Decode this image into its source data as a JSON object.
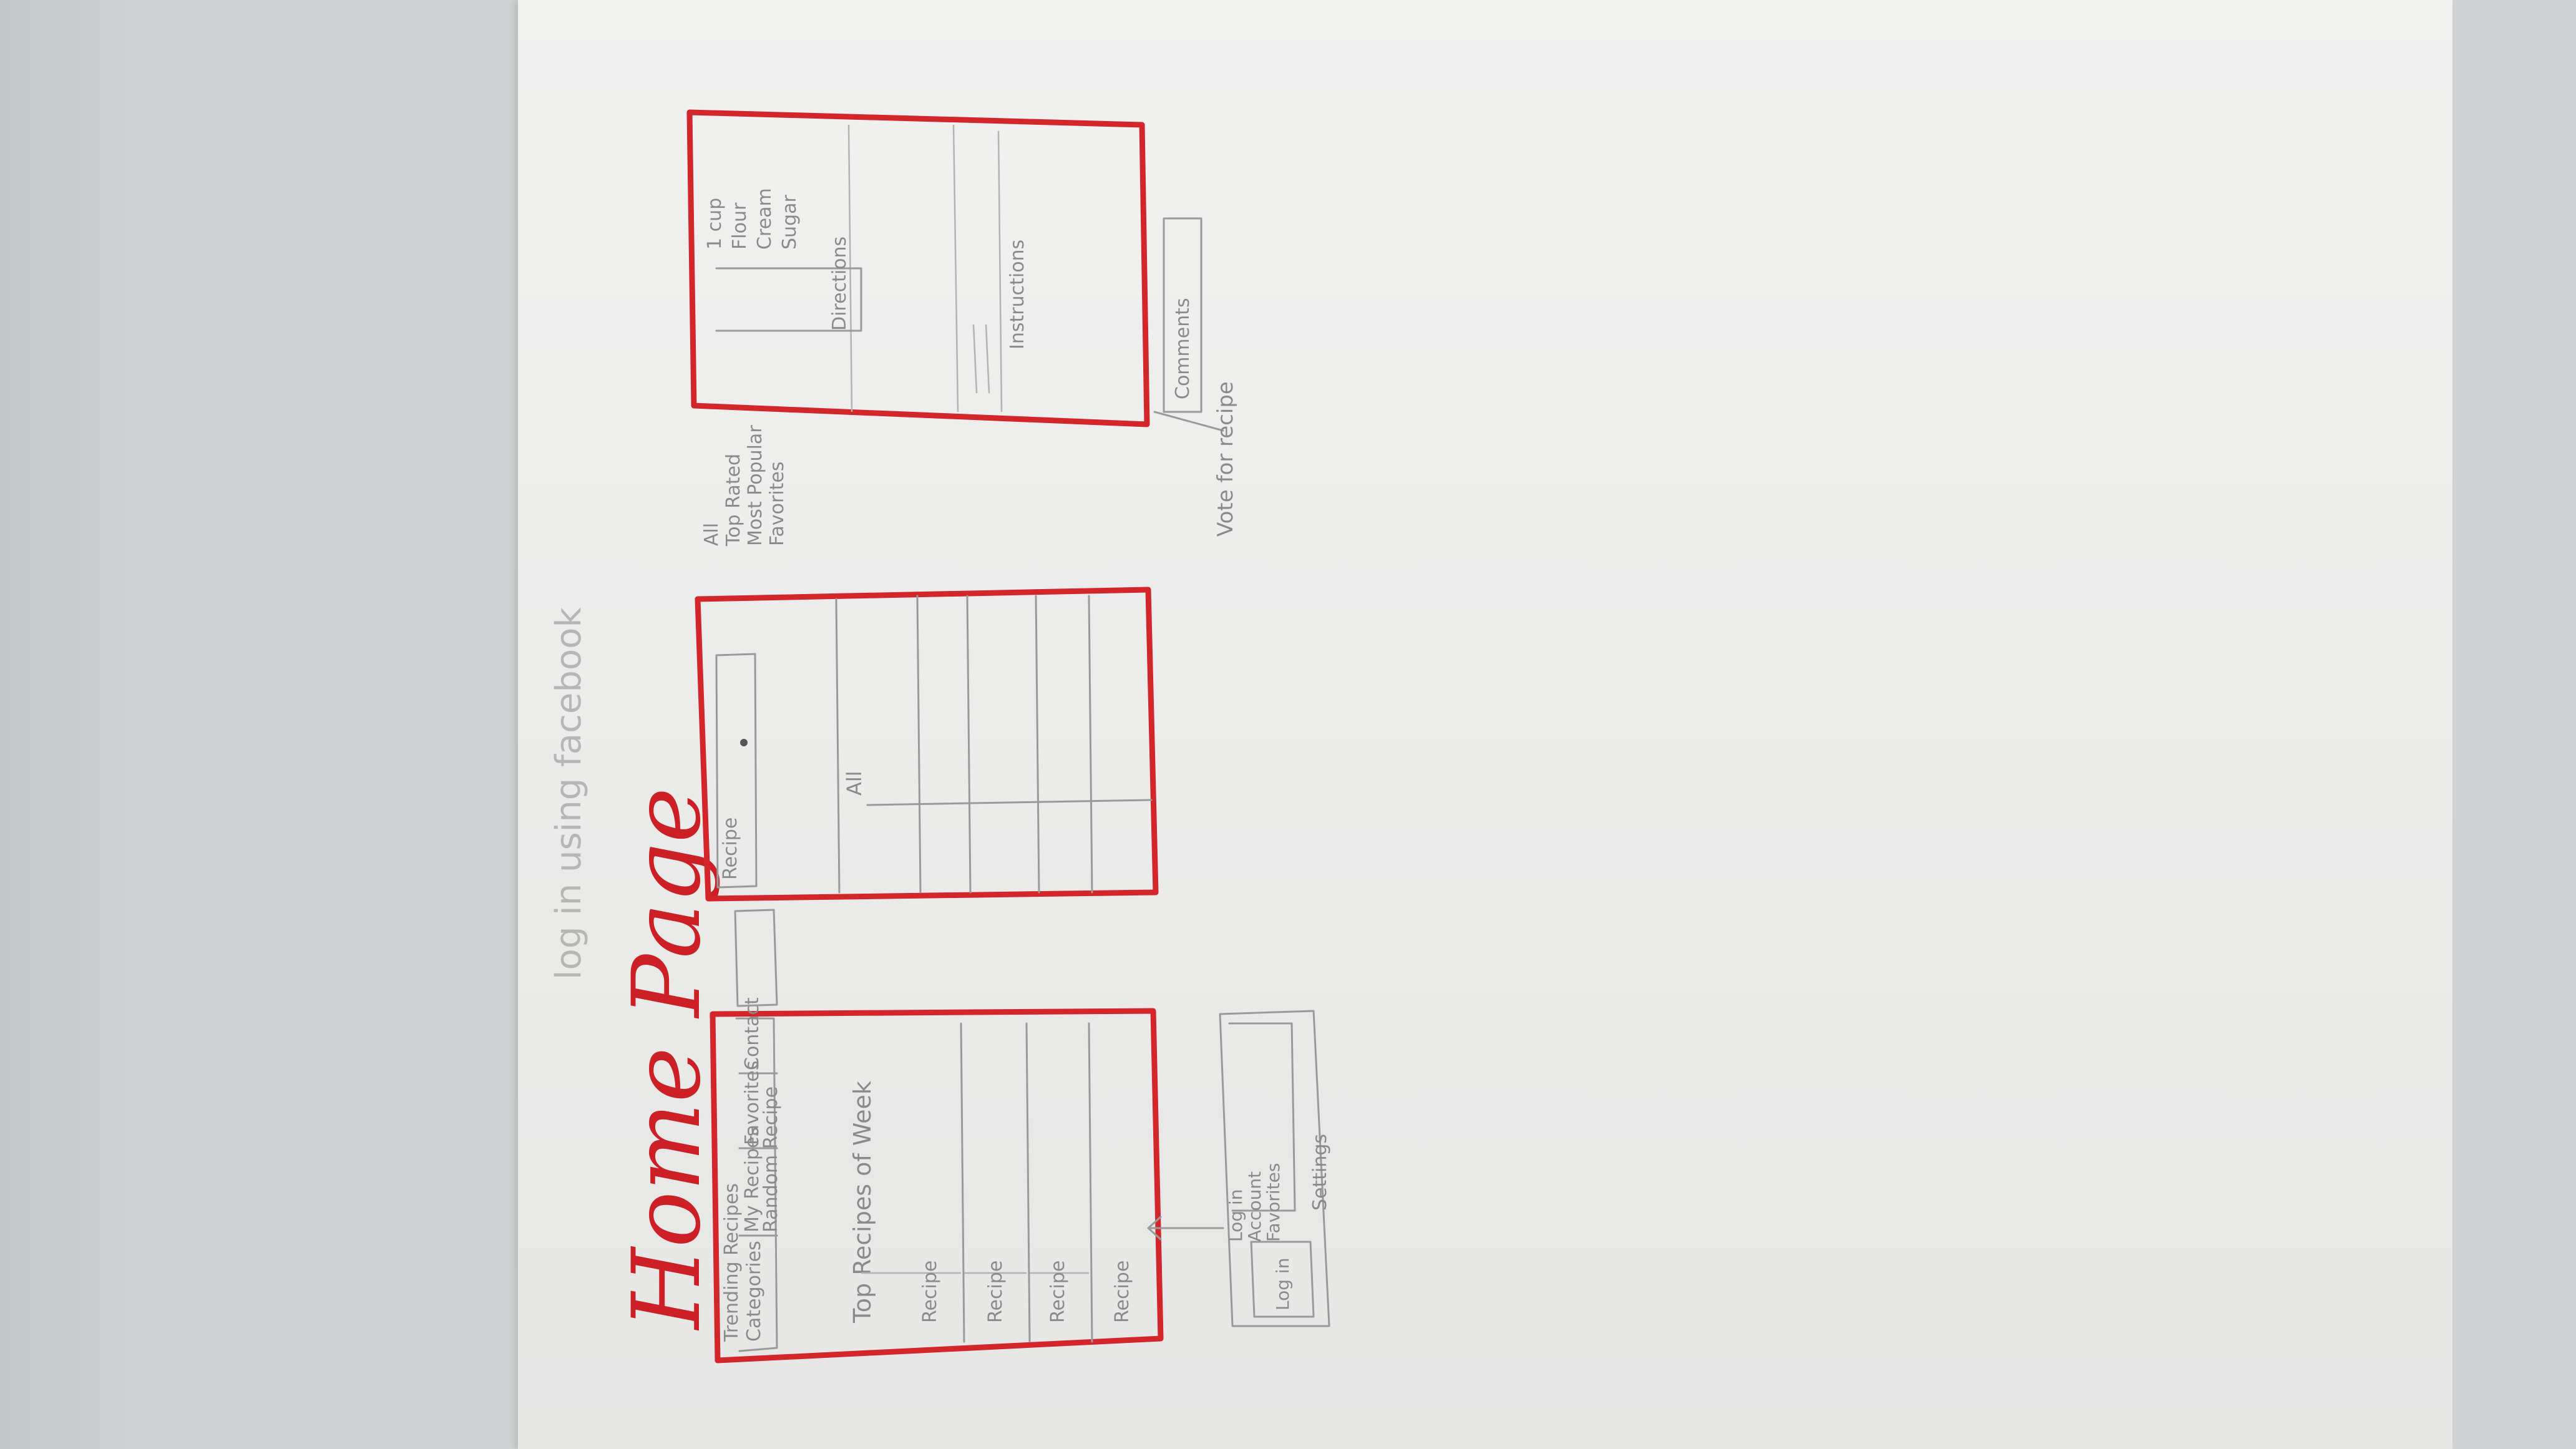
{
  "title": "Home Page",
  "faint_note": "log in using facebook",
  "home_screen": {
    "nav_labels": [
      "Trending Recipes",
      "Categories",
      "My Recipes",
      "Random Recipe",
      "Favorites",
      "Contact"
    ],
    "section_heading": "Top Recipes of Week",
    "card_labels": [
      "Recipe",
      "Recipe",
      "Recipe",
      "Recipe"
    ]
  },
  "search_screen": {
    "search_label": "Recipe",
    "filter_label": "All"
  },
  "filter_note": [
    "All",
    "Top Rated",
    "Most Popular",
    "Favorites"
  ],
  "detail_screen": {
    "ingredients": [
      "1 cup",
      "Flour",
      "Cream",
      "Sugar"
    ],
    "directions_label": "Directions",
    "instructions_label": "Instructions",
    "comments_label": "Comments"
  },
  "vote_note": "Vote for recipe",
  "popup_note": {
    "items": [
      "Log in",
      "Account",
      "Favorites"
    ],
    "label": "Settings"
  }
}
